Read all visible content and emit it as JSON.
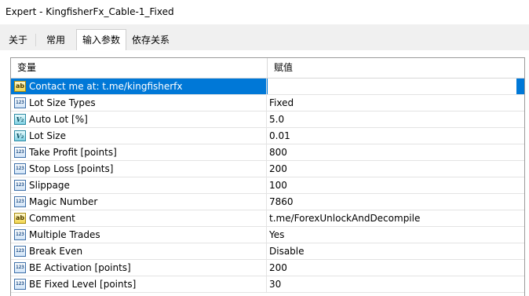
{
  "window": {
    "title": "Expert - KingfisherFx_Cable-1_Fixed"
  },
  "tabs": [
    {
      "label": "关于",
      "active": false
    },
    {
      "label": "常用",
      "active": false
    },
    {
      "label": "输入参数",
      "active": true
    },
    {
      "label": "依存关系",
      "active": false
    }
  ],
  "grid": {
    "columns": {
      "variable": "变量",
      "value": "赋值"
    },
    "rows": [
      {
        "icon": "string-ab-icon",
        "name": "Contact me at: t.me/kingfisherfx",
        "value": "",
        "selected": true
      },
      {
        "icon": "integer-123-icon",
        "name": "Lot Size Types",
        "value": "Fixed"
      },
      {
        "icon": "double-va-icon",
        "name": "Auto Lot [%]",
        "value": "5.0"
      },
      {
        "icon": "double-va-icon",
        "name": "Lot Size",
        "value": "0.01"
      },
      {
        "icon": "integer-123-icon",
        "name": "Take Profit [points]",
        "value": "800"
      },
      {
        "icon": "integer-123-icon",
        "name": "Stop Loss [points]",
        "value": "200"
      },
      {
        "icon": "integer-123-icon",
        "name": "Slippage",
        "value": "100"
      },
      {
        "icon": "integer-123-icon",
        "name": "Magic Number",
        "value": "7860"
      },
      {
        "icon": "string-ab-icon",
        "name": "Comment",
        "value": "t.me/ForexUnlockAndDecompile"
      },
      {
        "icon": "integer-123-icon",
        "name": "Multiple Trades",
        "value": "Yes"
      },
      {
        "icon": "integer-123-icon",
        "name": "Break Even",
        "value": "Disable"
      },
      {
        "icon": "integer-123-icon",
        "name": "BE Activation [points]",
        "value": "200"
      },
      {
        "icon": "integer-123-icon",
        "name": "BE Fixed Level [points]",
        "value": "30"
      }
    ]
  },
  "colors": {
    "selection": "#0078d7",
    "grid_border": "#9a9a9a"
  }
}
